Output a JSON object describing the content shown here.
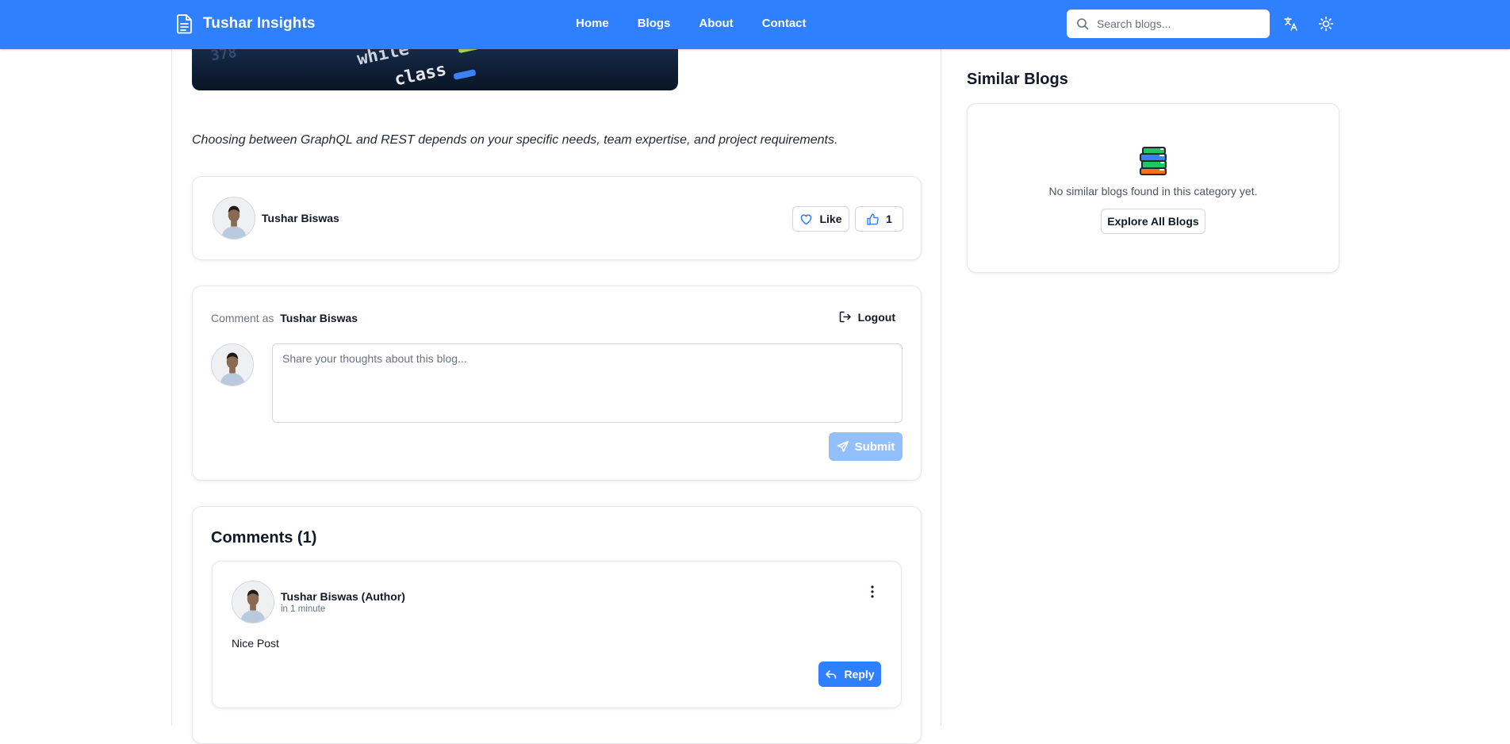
{
  "header": {
    "brand": "Tushar Insights",
    "nav": [
      "Home",
      "Blogs",
      "About",
      "Contact"
    ],
    "search_placeholder": "Search blogs...",
    "icons": [
      "language-icon",
      "sun-icon"
    ],
    "color": "#2f80ff"
  },
  "article": {
    "conclusion": "Choosing between GraphQL and REST depends on your specific needs, team expertise, and project requirements.",
    "hero_code_fragments": [
      "while",
      "class",
      "378"
    ]
  },
  "author_card": {
    "name": "Tushar Biswas",
    "like_label": "Like",
    "likes_count": "1"
  },
  "comment_form": {
    "label": "Comment as",
    "user": "Tushar Biswas",
    "logout_label": "Logout",
    "placeholder": "Share your thoughts about this blog...",
    "submit_label": "Submit"
  },
  "comments": {
    "title": "Comments (1)",
    "items": [
      {
        "author": "Tushar Biswas (Author)",
        "time": "in 1 minute",
        "text": "Nice Post",
        "reply_label": "Reply"
      }
    ]
  },
  "sidebar": {
    "title": "Similar Blogs",
    "empty_message": "No similar blogs found in this category yet.",
    "explore_label": "Explore All Blogs"
  }
}
